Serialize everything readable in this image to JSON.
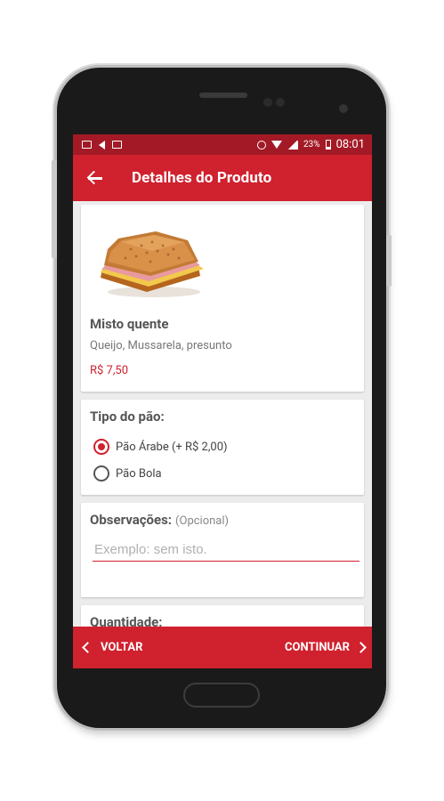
{
  "status_bar": {
    "battery_pct": "23%",
    "time": "08:01"
  },
  "app_bar": {
    "title": "Detalhes do Produto"
  },
  "product": {
    "name": "Misto quente",
    "description": "Queijo, Mussarela, presunto",
    "price": "R$ 7,50"
  },
  "bread": {
    "label": "Tipo do pão:",
    "options": [
      {
        "label": "Pão Árabe (+ R$ 2,00)",
        "selected": true
      },
      {
        "label": "Pão Bola",
        "selected": false
      }
    ]
  },
  "notes": {
    "label": "Observações:",
    "optional": "(Opcional)",
    "placeholder": "Exemplo: sem isto.",
    "value": ""
  },
  "quantity": {
    "label": "Quantidade:"
  },
  "bottom_nav": {
    "prev_label": "VOLTAR",
    "next_label": "CONTINUAR"
  },
  "colors": {
    "primary": "#d0212e",
    "status_bar": "#a31a26",
    "background": "#ececec"
  }
}
